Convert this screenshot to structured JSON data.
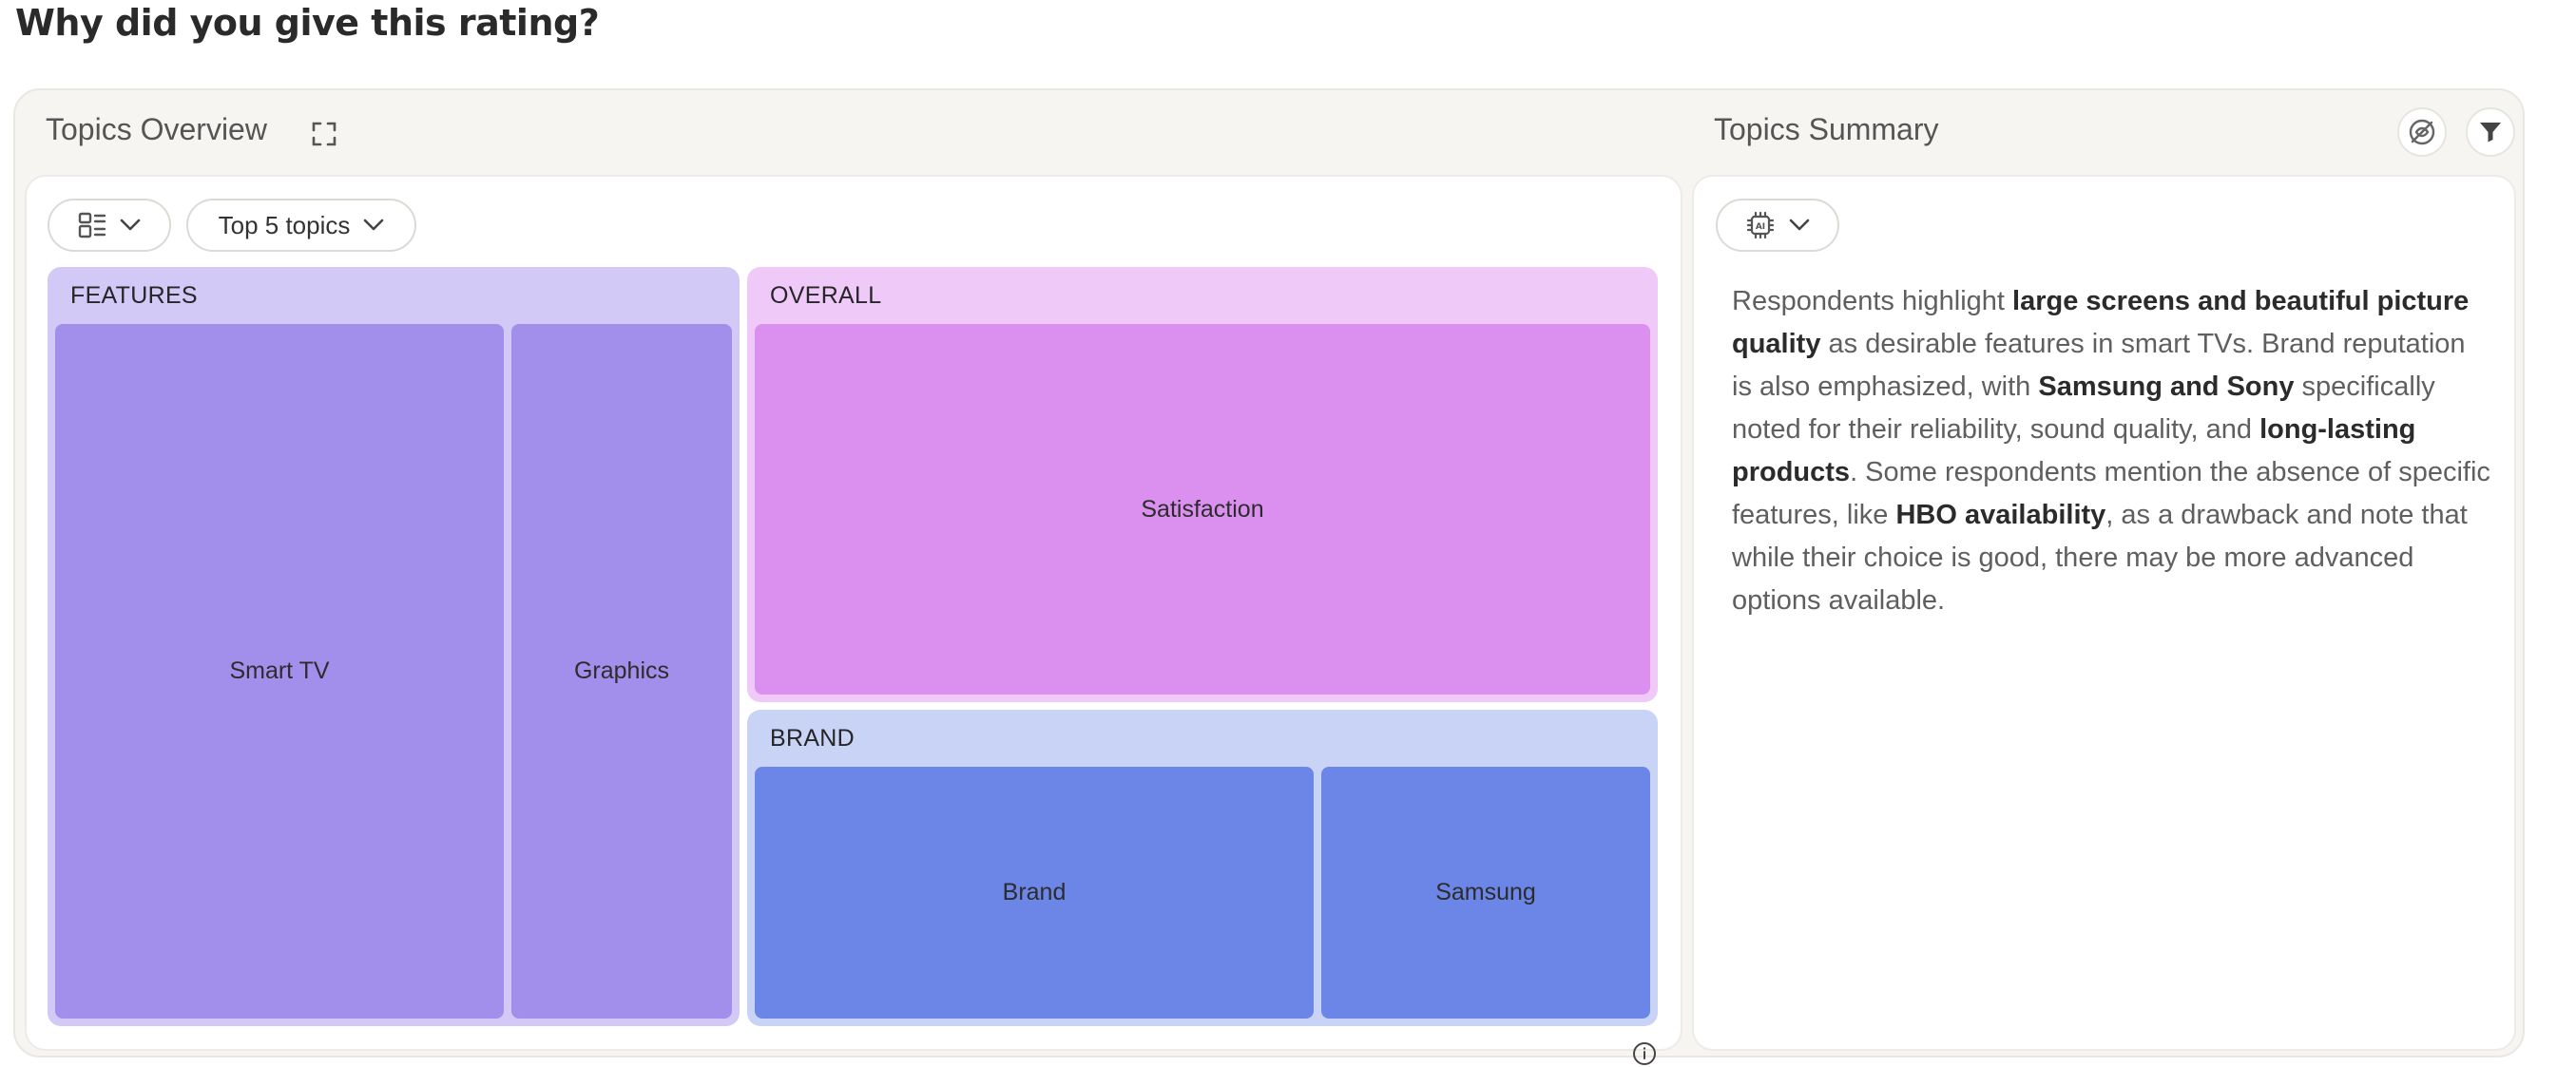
{
  "page": {
    "title": "Why did you give this rating?"
  },
  "overview": {
    "title": "Topics Overview",
    "toolbar": {
      "topics_select": "Top 5 topics"
    },
    "treemap": {
      "groups": [
        {
          "label": "FEATURES",
          "color": "#d2c9f6",
          "tiles": [
            {
              "label": "Smart TV",
              "color": "#a28fec"
            },
            {
              "label": "Graphics",
              "color": "#a28fec"
            }
          ]
        },
        {
          "label": "OVERALL",
          "color": "#efc9f8",
          "tiles": [
            {
              "label": "Satisfaction",
              "color": "#db90ef"
            }
          ]
        },
        {
          "label": "BRAND",
          "color": "#c9d3f6",
          "tiles": [
            {
              "label": "Brand",
              "color": "#6b86e6"
            },
            {
              "label": "Samsung",
              "color": "#6b86e6"
            }
          ]
        }
      ]
    }
  },
  "summary": {
    "title": "Topics Summary",
    "segments": [
      {
        "text": "Respondents highlight ",
        "bold": false
      },
      {
        "text": "large screens and beautiful picture quality",
        "bold": true
      },
      {
        "text": " as desirable features in smart TVs. Brand reputation is also emphasized, with ",
        "bold": false
      },
      {
        "text": "Samsung and Sony",
        "bold": true
      },
      {
        "text": " specifically noted for their reliability, sound quality, and ",
        "bold": false
      },
      {
        "text": "long-lasting products",
        "bold": true
      },
      {
        "text": ". Some respondents mention the absence of specific features, like ",
        "bold": false
      },
      {
        "text": "HBO availability",
        "bold": true
      },
      {
        "text": ", as a drawback and note that while their choice is good, there may be more advanced options available.",
        "bold": false
      }
    ]
  },
  "icons": {
    "expand": "expand-icon",
    "layout": "layout-grid-icon",
    "chevron": "chevron-down-icon",
    "ai": "ai-chip-icon",
    "hide": "eye-off-icon",
    "filter": "filter-icon",
    "info": "info-icon"
  }
}
